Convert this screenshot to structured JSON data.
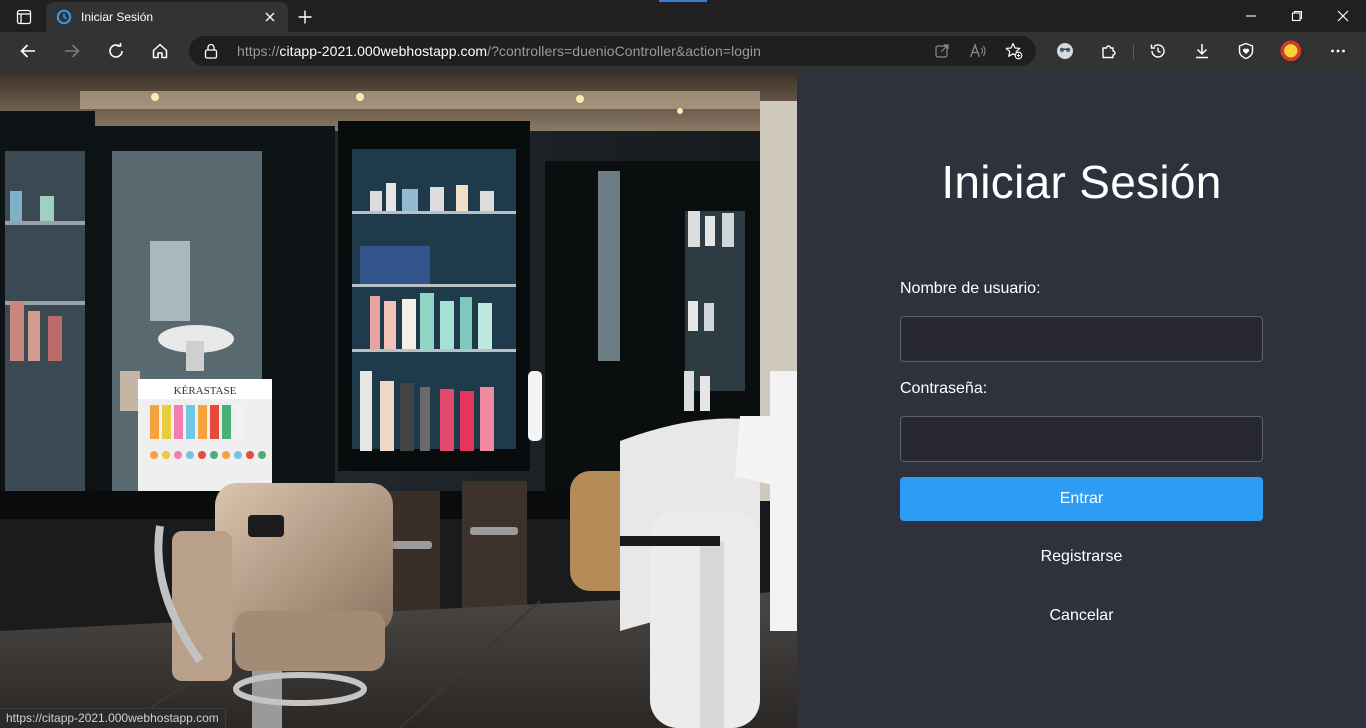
{
  "browser": {
    "tab": {
      "title": "Iniciar Sesión"
    },
    "address": {
      "scheme": "https://",
      "host": "citapp-2021.000webhostapp.com",
      "path": "/?controllers=duenioController&action=login"
    },
    "icons": {
      "tab_actions": "tab-actions-icon",
      "favicon": "clock-icon",
      "close": "close-icon",
      "new_tab": "plus-icon",
      "back": "back-arrow-icon",
      "forward": "forward-arrow-icon",
      "refresh": "refresh-icon",
      "home": "home-icon",
      "lock": "lock-icon",
      "open_in_app": "open-in-app-icon",
      "read_aloud": "read-aloud-icon",
      "favorite": "star-add-icon",
      "extension_ghost": "ghost-extension-icon",
      "extensions": "puzzle-icon",
      "history": "history-icon",
      "downloads": "download-icon",
      "browser_essentials": "shield-heart-icon",
      "profile": "avatar-icon",
      "menu": "more-icon"
    },
    "status_url": "https://citapp-2021.000webhostapp.com"
  },
  "login": {
    "title": "Iniciar Sesión",
    "username_label": "Nombre de usuario:",
    "username_value": "",
    "password_label": "Contraseña:",
    "password_value": "",
    "submit_label": "Entrar",
    "register_label": "Registrarse",
    "cancel_label": "Cancelar"
  },
  "colors": {
    "panel_bg": "#2e323d",
    "input_bg": "#272831",
    "primary": "#2d9cf5",
    "chrome_bg": "#202020",
    "toolbar_bg": "#333333"
  }
}
